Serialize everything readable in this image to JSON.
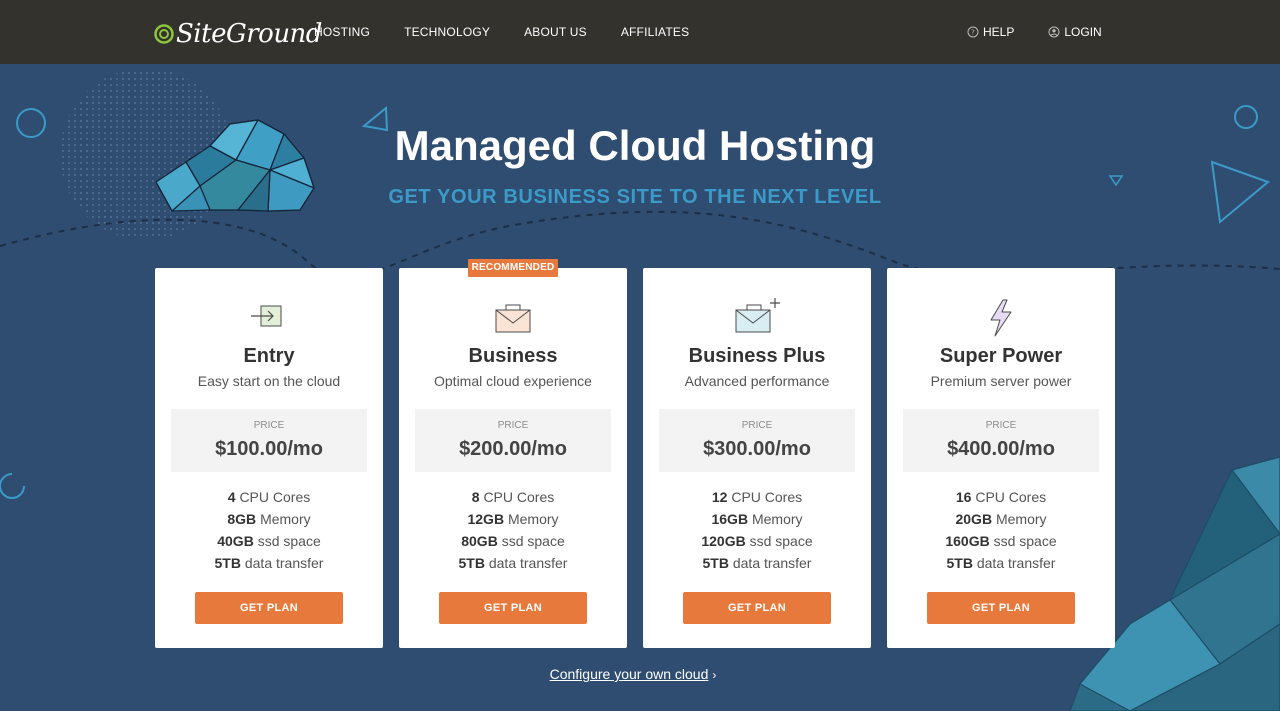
{
  "header": {
    "logo_text": "SiteGround",
    "nav": [
      "HOSTING",
      "TECHNOLOGY",
      "ABOUT US",
      "AFFILIATES"
    ],
    "help_label": "HELP",
    "login_label": "LOGIN"
  },
  "hero": {
    "title": "Managed Cloud Hosting",
    "subtitle": "GET YOUR BUSINESS SITE TO THE NEXT LEVEL"
  },
  "badge": "RECOMMENDED",
  "price_label": "PRICE",
  "button_label": "GET PLAN",
  "plans": [
    {
      "name": "Entry",
      "desc": "Easy start on the cloud",
      "price": "$100.00/mo",
      "cpu": "4",
      "cpu_unit": "CPU Cores",
      "mem": "8GB",
      "mem_unit": "Memory",
      "ssd": "40GB",
      "ssd_unit": "ssd space",
      "transfer": "5TB",
      "transfer_unit": "data transfer"
    },
    {
      "name": "Business",
      "desc": "Optimal cloud experience",
      "price": "$200.00/mo",
      "cpu": "8",
      "cpu_unit": "CPU Cores",
      "mem": "12GB",
      "mem_unit": "Memory",
      "ssd": "80GB",
      "ssd_unit": "ssd space",
      "transfer": "5TB",
      "transfer_unit": "data transfer"
    },
    {
      "name": "Business Plus",
      "desc": "Advanced performance",
      "price": "$300.00/mo",
      "cpu": "12",
      "cpu_unit": "CPU Cores",
      "mem": "16GB",
      "mem_unit": "Memory",
      "ssd": "120GB",
      "ssd_unit": "ssd space",
      "transfer": "5TB",
      "transfer_unit": "data transfer"
    },
    {
      "name": "Super Power",
      "desc": "Premium server power",
      "price": "$400.00/mo",
      "cpu": "16",
      "cpu_unit": "CPU Cores",
      "mem": "20GB",
      "mem_unit": "Memory",
      "ssd": "160GB",
      "ssd_unit": "ssd space",
      "transfer": "5TB",
      "transfer_unit": "data transfer"
    }
  ],
  "configure_link": "Configure your own cloud",
  "icons": {
    "plan_icons": [
      "enter-icon",
      "briefcase-icon",
      "briefcase-plus-icon",
      "lightning-icon"
    ],
    "help": "question-icon",
    "login": "user-icon"
  },
  "colors": {
    "accent": "#e8793d",
    "header_bg": "#34322c",
    "page_bg": "#2f4d71",
    "subtitle": "#3c9ac8"
  }
}
